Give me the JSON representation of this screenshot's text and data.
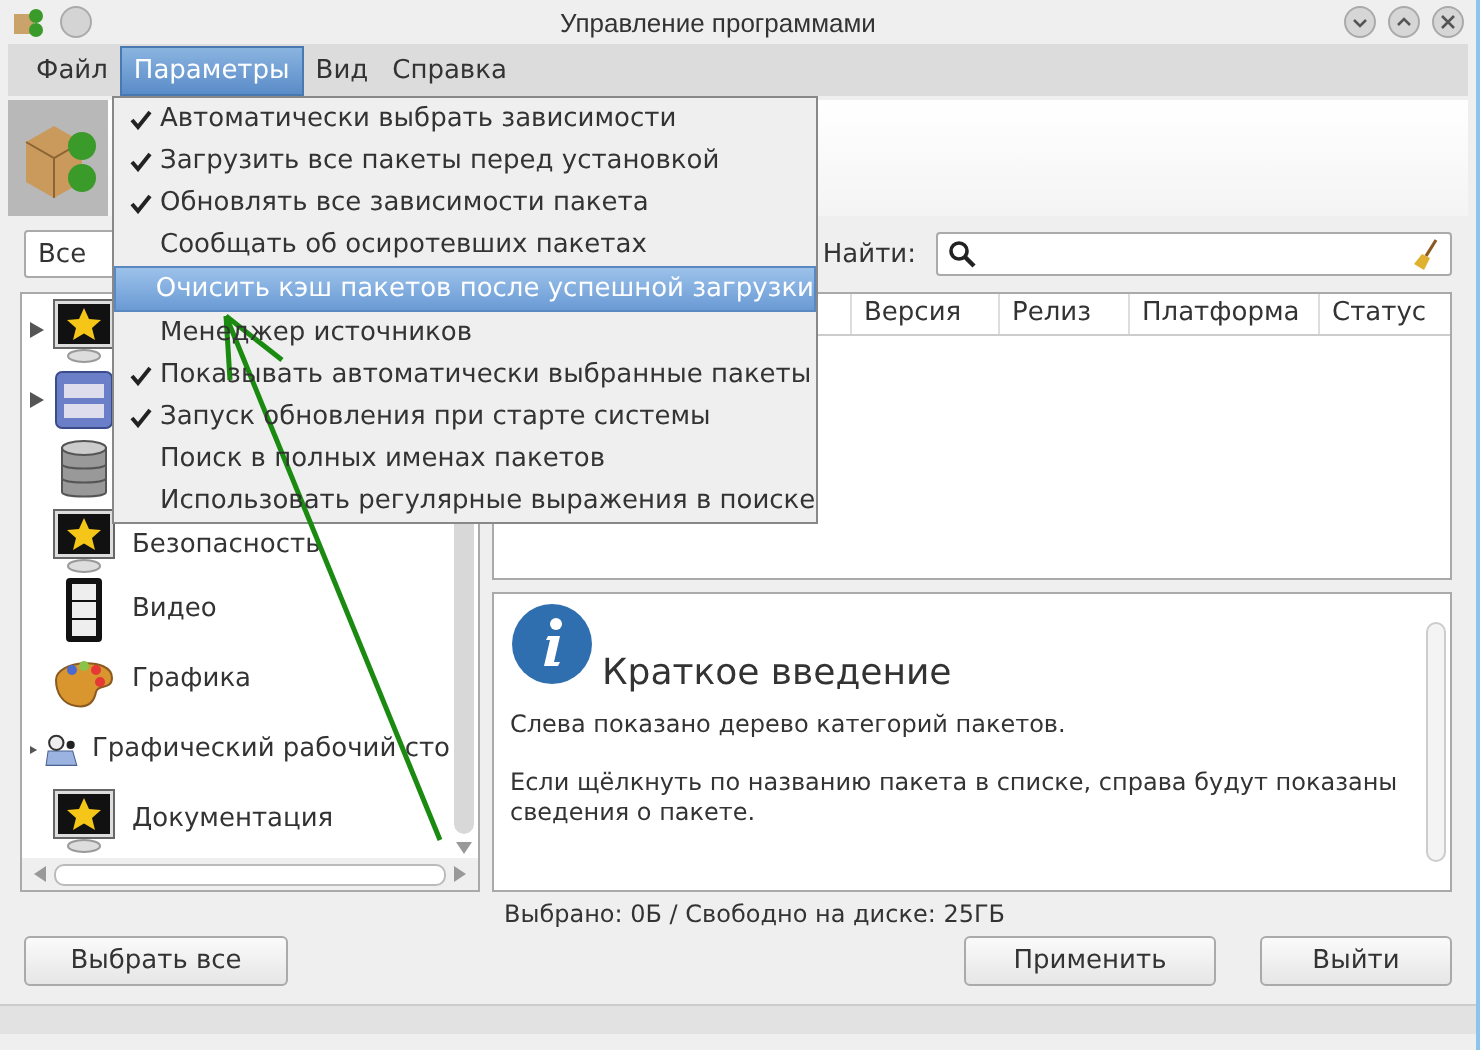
{
  "window": {
    "title": "Управление программами"
  },
  "menubar": [
    {
      "label": "Файл",
      "selected": false
    },
    {
      "label": "Параметры",
      "selected": true
    },
    {
      "label": "Вид",
      "selected": false
    },
    {
      "label": "Справка",
      "selected": false
    }
  ],
  "menu": {
    "items": [
      {
        "label": "Автоматически выбрать зависимости",
        "checked": true,
        "selected": false
      },
      {
        "label": "Загрузить все пакеты перед установкой",
        "checked": true,
        "selected": false
      },
      {
        "label": "Обновлять все зависимости пакета",
        "checked": true,
        "selected": false
      },
      {
        "label": "Сообщать об осиротевших пакетах",
        "checked": false,
        "selected": false
      },
      {
        "label": "Очисить кэш пакетов после успешной загрузки",
        "checked": false,
        "selected": true
      },
      {
        "label": "Менеджер источников",
        "checked": false,
        "selected": false
      },
      {
        "label": "Показывать автоматически выбранные пакеты",
        "checked": true,
        "selected": false
      },
      {
        "label": "Запуск обновления при старте системы",
        "checked": true,
        "selected": false
      },
      {
        "label": "Поиск в полных именах пакетов",
        "checked": false,
        "selected": false
      },
      {
        "label": "Использовать регулярные выражения в поиске",
        "checked": false,
        "selected": false
      }
    ]
  },
  "filter": {
    "value": "Все"
  },
  "search": {
    "label": "Найти:"
  },
  "categories": [
    {
      "kind": "monitor-star",
      "expandable": true
    },
    {
      "kind": "drawer",
      "expandable": true
    },
    {
      "kind": "database",
      "expandable": false
    },
    {
      "kind": "monitor-star",
      "label": "Безопасность",
      "expandable": false
    },
    {
      "kind": "film",
      "label": "Видео",
      "expandable": false
    },
    {
      "kind": "palette",
      "label": "Графика",
      "expandable": false
    },
    {
      "kind": "desktop",
      "label": "Графический рабочий сто",
      "expandable": true
    },
    {
      "kind": "monitor-star",
      "label": "Документация",
      "expandable": false
    }
  ],
  "table": {
    "columns": [
      "Версия",
      "Релиз",
      "Платформа",
      "Статус"
    ]
  },
  "info": {
    "title": "Краткое введение",
    "paragraphs": [
      "Слева показано дерево категорий пакетов.",
      "Если щёлкнуть по названию пакета в списке, справа будут показаны сведения о пакете."
    ]
  },
  "status": "Выбрано: 0Б / Свободно на диске: 25ГБ",
  "buttons": {
    "select_all": "Выбрать все",
    "apply": "Применить",
    "quit": "Выйти"
  }
}
